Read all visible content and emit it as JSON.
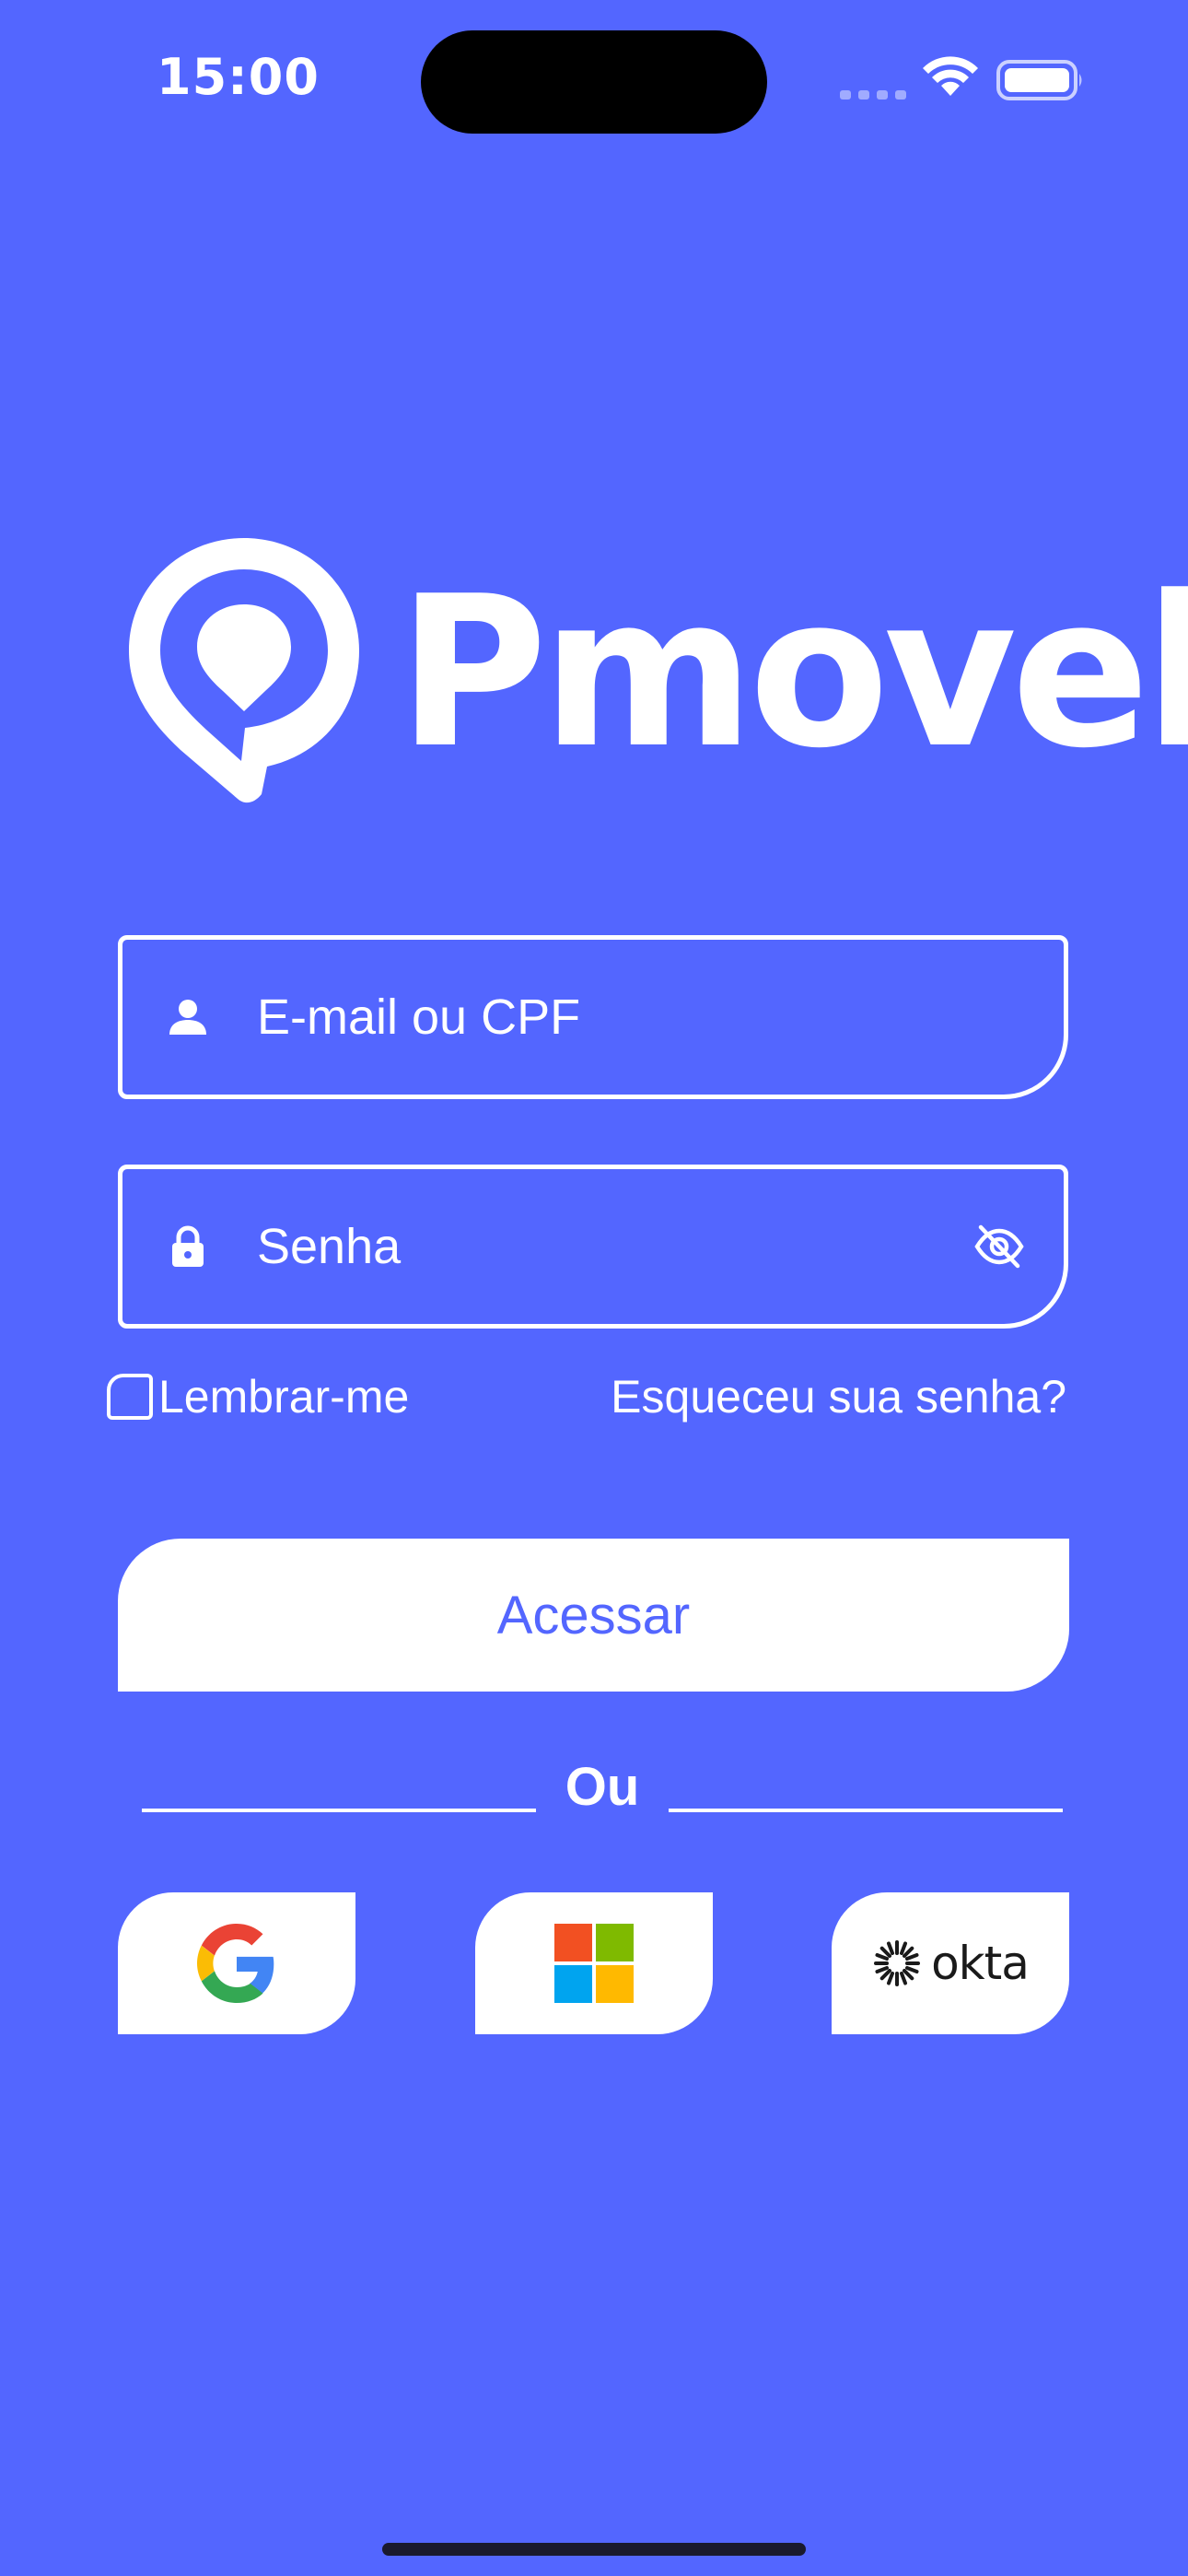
{
  "status_bar": {
    "time": "15:00"
  },
  "logo": {
    "text": "Pmovel",
    "icon": "location-pin-icon"
  },
  "login_form": {
    "email_placeholder": "E-mail ou CPF",
    "password_placeholder": "Senha",
    "remember_label": "Lembrar-me",
    "forgot_label": "Esqueceu sua senha?",
    "submit_label": "Acessar"
  },
  "divider": {
    "text": "Ou"
  },
  "social_login": {
    "providers": [
      "google",
      "microsoft",
      "okta"
    ],
    "okta_label": "okta"
  },
  "colors": {
    "background": "#5366FF",
    "accent": "#5366FF",
    "foreground": "#FFFFFF"
  }
}
